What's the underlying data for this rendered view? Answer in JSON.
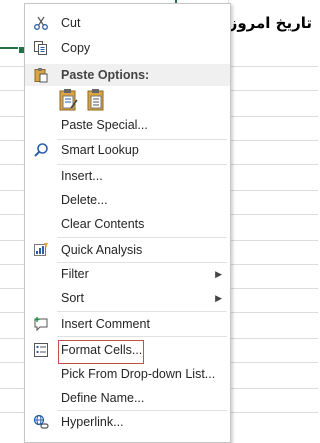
{
  "sheet": {
    "cell_text": "تاریخ امروز"
  },
  "menu": {
    "items": [
      {
        "name": "cut",
        "label": "Cut",
        "icon": "scissors-icon"
      },
      {
        "name": "copy",
        "label": "Copy",
        "icon": "copy-icon"
      },
      {
        "name": "paste-options",
        "label": "Paste Options:",
        "icon": "clipboard-icon"
      },
      {
        "name": "paste-special",
        "label": "Paste Special..."
      },
      {
        "name": "smart-lookup",
        "label": "Smart Lookup",
        "icon": "search-icon"
      },
      {
        "name": "insert",
        "label": "Insert..."
      },
      {
        "name": "delete",
        "label": "Delete..."
      },
      {
        "name": "clear-contents",
        "label": "Clear Contents"
      },
      {
        "name": "quick-analysis",
        "label": "Quick Analysis",
        "icon": "quick-analysis-icon"
      },
      {
        "name": "filter",
        "label": "Filter"
      },
      {
        "name": "sort",
        "label": "Sort"
      },
      {
        "name": "insert-comment",
        "label": "Insert Comment",
        "icon": "comment-icon"
      },
      {
        "name": "format-cells",
        "label": "Format Cells...",
        "icon": "format-cells-icon"
      },
      {
        "name": "pick-from-dropdown",
        "label": "Pick From Drop-down List..."
      },
      {
        "name": "define-name",
        "label": "Define Name..."
      },
      {
        "name": "hyperlink",
        "label": "Hyperlink...",
        "icon": "hyperlink-icon"
      }
    ],
    "submenu_arrow": "▶",
    "paste_buttons": [
      "paste-icon",
      "paste-values-icon"
    ]
  },
  "colors": {
    "selection_border": "#217346",
    "highlight_box": "#c0504d"
  }
}
